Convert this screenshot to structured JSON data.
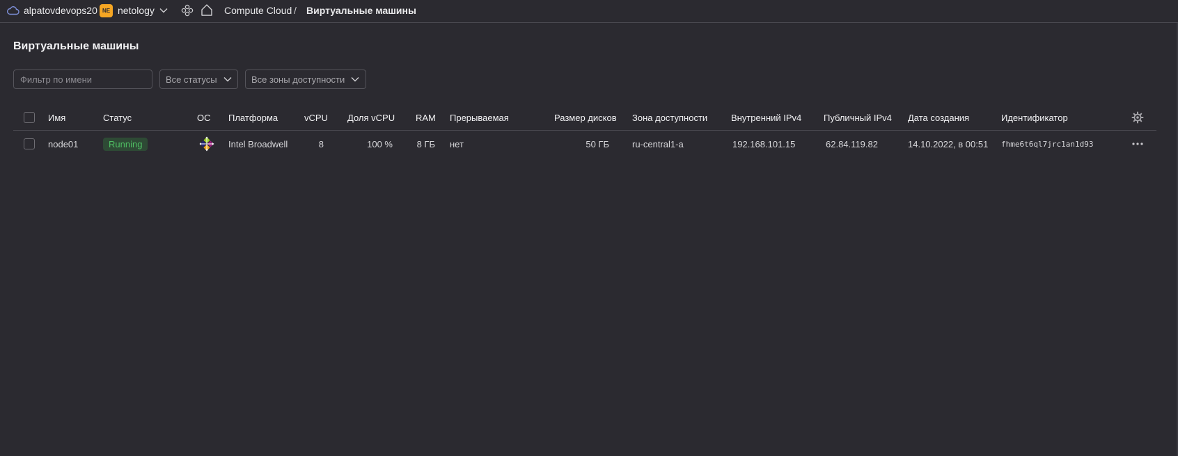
{
  "topbar": {
    "cloud_name": "alpatovdevops20",
    "folder_badge": "NE",
    "folder_name": "netology",
    "breadcrumb_service": "Compute Cloud",
    "breadcrumb_separator": "/",
    "breadcrumb_current": "Виртуальные машины"
  },
  "page": {
    "title": "Виртуальные машины"
  },
  "filters": {
    "name_placeholder": "Фильтр по имени",
    "status_value": "Все статусы",
    "zone_value": "Все зоны доступности"
  },
  "table": {
    "columns": {
      "name": "Имя",
      "status": "Статус",
      "os": "ОС",
      "platform": "Платформа",
      "vcpu": "vCPU",
      "vcpu_share": "Доля vCPU",
      "ram": "RAM",
      "preemptible": "Прерываемая",
      "disk_size": "Размер дисков",
      "zone": "Зона доступности",
      "internal_ip": "Внутренний IPv4",
      "public_ip": "Публичный IPv4",
      "created": "Дата создания",
      "id": "Идентификатор"
    },
    "rows": [
      {
        "name": "node01",
        "status": "Running",
        "os_icon": "centos-icon",
        "platform": "Intel Broadwell",
        "vcpu": "8",
        "vcpu_share": "100 %",
        "ram": "8 ГБ",
        "preemptible": "нет",
        "disk_size": "50 ГБ",
        "zone": "ru-central1-a",
        "internal_ip": "192.168.101.15",
        "public_ip": "62.84.119.82",
        "created": "14.10.2022, в 00:51",
        "id": "fhme6t6ql7jrc1an1d93"
      }
    ]
  },
  "colors": {
    "background": "#2b2a30",
    "status_running": "#4fbf63",
    "folder_badge": "#f6a623"
  }
}
